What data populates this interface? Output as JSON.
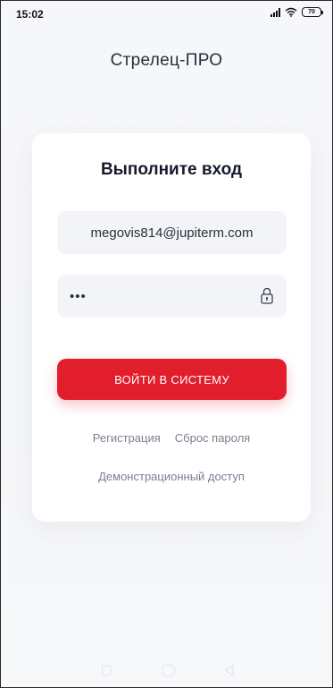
{
  "status_bar": {
    "time": "15:02",
    "battery_level": "70",
    "icons": [
      "signal-icon",
      "wifi-icon",
      "battery-icon"
    ]
  },
  "app_title": "Стрелец-ПРО",
  "login_card": {
    "title": "Выполните вход",
    "email_value": "megovis814@jupiterm.com",
    "password_value": "•••",
    "password_icon": "lock-icon",
    "submit_label": "ВОЙТИ В СИСТЕМУ",
    "register_link": "Регистрация",
    "reset_link": "Сброс пароля",
    "demo_link": "Демонстрационный доступ"
  },
  "nav_bar": {
    "icons": [
      "recent-apps-icon",
      "home-icon",
      "back-icon"
    ]
  },
  "colors": {
    "accent": "#e21d2c",
    "background": "#f6f7fa",
    "card": "#ffffff",
    "field": "#f3f4f8",
    "link": "#7b7f8e"
  }
}
